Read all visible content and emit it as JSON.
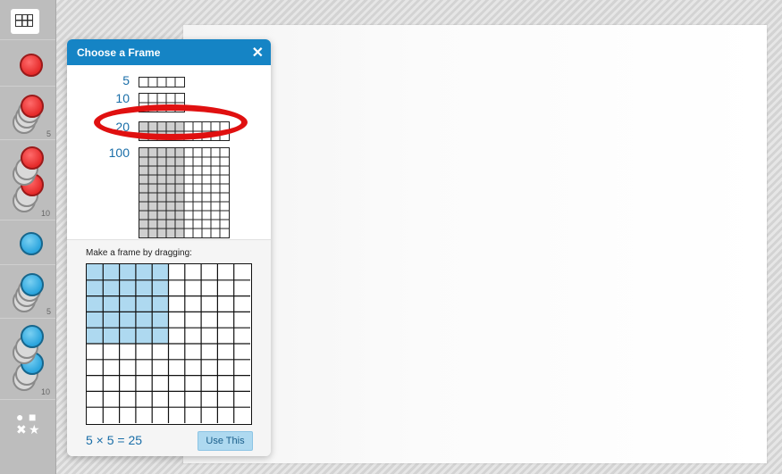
{
  "toolbar": {
    "frames_tool": "frames-grid-icon",
    "counter_counts": {
      "red_5": "5",
      "red_10": "10",
      "blue_5": "5",
      "blue_10": "10"
    },
    "colors": {
      "red": "#e52a2a",
      "blue": "#2aa4dd"
    }
  },
  "dialog": {
    "title": "Choose a Frame",
    "close_label": "✕",
    "presets": [
      {
        "label": "5",
        "cols": 5,
        "rows": 1
      },
      {
        "label": "10",
        "cols": 5,
        "rows": 2
      },
      {
        "label": "20",
        "cols": 10,
        "rows": 2
      },
      {
        "label": "100",
        "cols": 10,
        "rows": 10
      }
    ],
    "drag_instruction": "Make a frame by dragging:",
    "drag_grid": {
      "cols": 10,
      "rows": 10,
      "selected_cols": 5,
      "selected_rows": 5
    },
    "equation": "5 × 5 = 25",
    "use_button": "Use This"
  },
  "accent": {
    "header": "#1584c5",
    "selection": "#aed9f0",
    "highlight": "#e01010"
  }
}
